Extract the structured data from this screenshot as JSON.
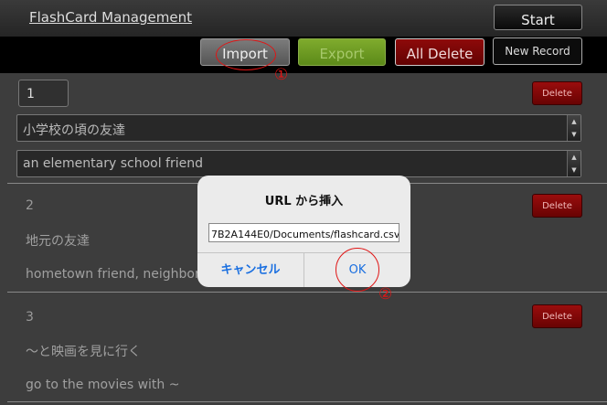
{
  "header": {
    "app_title": "FlashCard  Management",
    "start_label": "Start"
  },
  "toolbar": {
    "import_label": "Import",
    "export_label": "Export",
    "all_delete_label": "All Delete",
    "new_record_label": "New Record"
  },
  "annotations": {
    "marker_1": "①",
    "marker_2": "②",
    "color": "#e01515"
  },
  "records": [
    {
      "number": "1",
      "delete_label": "Delete",
      "question": "小学校の頃の友達",
      "answer": "an elementary school friend"
    },
    {
      "number": "2",
      "delete_label": "Delete",
      "question": "地元の友達",
      "answer": "hometown friend, neighbor"
    },
    {
      "number": "3",
      "delete_label": "Delete",
      "question": "〜と映画を見に行く",
      "answer": "go to the movies with ~"
    }
  ],
  "dialog": {
    "title": "URL から挿入",
    "url_value": "7B2A144E0/Documents/flashcard.csv",
    "cancel_label": "キャンセル",
    "ok_label": "OK"
  },
  "colors": {
    "delete_red": "#8a0808",
    "export_green": "#6f9b22",
    "link_blue": "#1a6fe0"
  }
}
